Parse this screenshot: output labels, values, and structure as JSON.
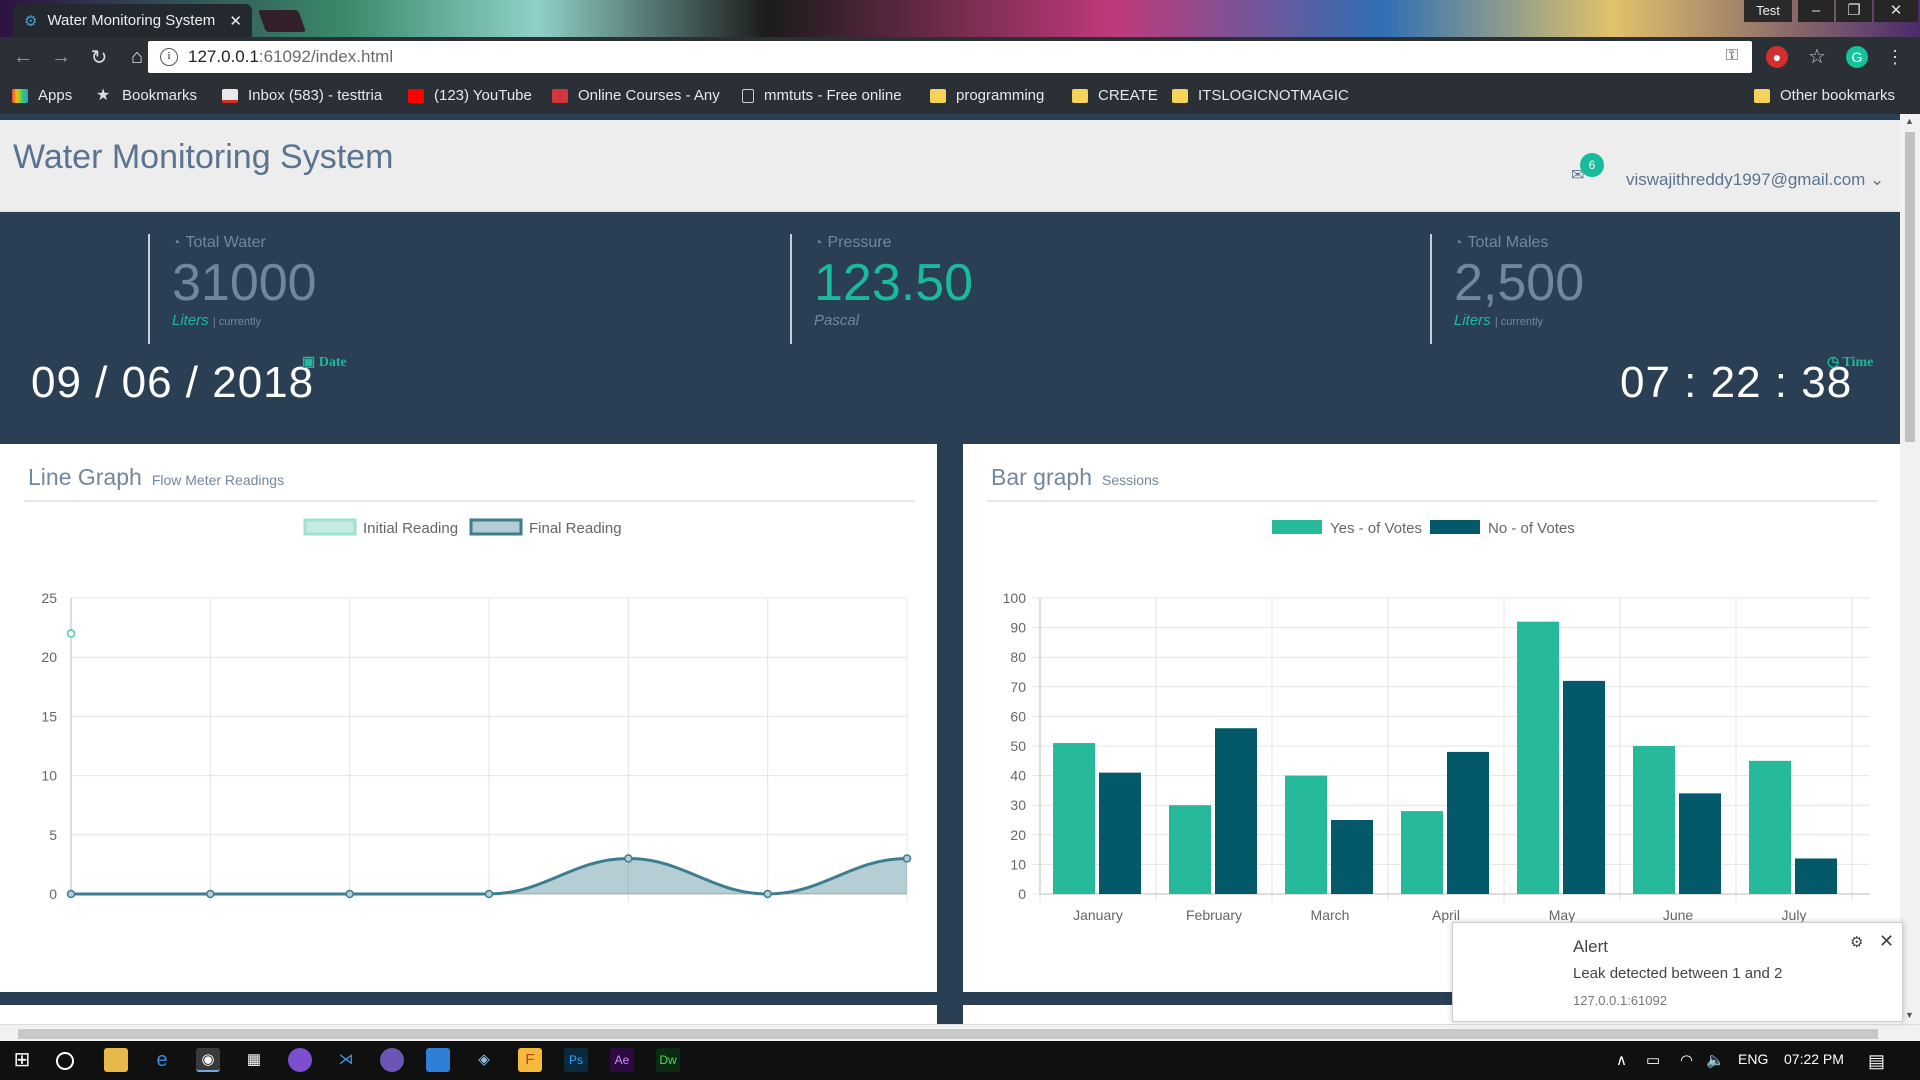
{
  "browser": {
    "tab_title": "Water Monitoring System",
    "profile": "Test",
    "url_host": "127.0.0.1",
    "url_rest": ":61092/index.html",
    "bookmarks": [
      "Apps",
      "Bookmarks",
      "Inbox (583) - testtria",
      "(123) YouTube",
      "Online Courses - Any",
      "mmtuts - Free online",
      "programming",
      "CREATE",
      "ITSLOGICNOTMAGIC"
    ],
    "other_bookmarks": "Other bookmarks"
  },
  "app": {
    "title": "Water Monitoring System",
    "notification_count": "6",
    "user": "viswajithreddy1997@gmail.com"
  },
  "stats": [
    {
      "label": "Total Water",
      "value": "31000",
      "unit": "Liters",
      "note": "| currently"
    },
    {
      "label": "Pressure",
      "value": "123.50",
      "unit": "Pascal",
      "note": ""
    },
    {
      "label": "Total Males",
      "value": "2,500",
      "unit": "Liters",
      "note": "| currently"
    }
  ],
  "date": {
    "value": "09 / 06 / 2018",
    "label": "Date"
  },
  "time": {
    "value": "07 : 22 : 38",
    "label": "Time"
  },
  "line_panel": {
    "title": "Line Graph",
    "subtitle": "Flow Meter Readings"
  },
  "bar_panel": {
    "title": "Bar graph",
    "subtitle": "Sessions"
  },
  "chart_data": [
    {
      "type": "line",
      "x": [
        "",
        "",
        "",
        "",
        "",
        "",
        ""
      ],
      "series": [
        {
          "name": "Initial Reading",
          "values": [
            22,
            null,
            null,
            null,
            null,
            null,
            null
          ],
          "color": "#9fe0d2"
        },
        {
          "name": "Final Reading",
          "values": [
            0,
            0,
            0,
            0,
            3,
            0,
            3
          ],
          "color": "#3d7d8e"
        }
      ],
      "ylim": [
        0,
        25
      ],
      "yticks": [
        0,
        5,
        10,
        15,
        20,
        25
      ],
      "grid": true,
      "legend": "top"
    },
    {
      "type": "bar",
      "categories": [
        "January",
        "February",
        "March",
        "April",
        "May",
        "June",
        "July"
      ],
      "series": [
        {
          "name": "Yes - of Votes",
          "values": [
            51,
            30,
            40,
            28,
            92,
            50,
            45
          ],
          "color": "#26b99a"
        },
        {
          "name": "No - of Votes",
          "values": [
            41,
            56,
            25,
            48,
            72,
            34,
            12
          ],
          "color": "#03586a"
        }
      ],
      "ylim": [
        0,
        100
      ],
      "yticks": [
        0,
        10,
        20,
        30,
        40,
        50,
        60,
        70,
        80,
        90,
        100
      ],
      "grid": true,
      "legend": "top"
    }
  ],
  "notification": {
    "title": "Alert",
    "message": "Leak detected between 1 and 2",
    "source": "127.0.0.1:61092"
  },
  "taskbar": {
    "lang": "ENG",
    "clock": "07:22 PM"
  },
  "icons": [
    "calendar-icon",
    "clock-icon",
    "dashboard-icon",
    "envelope-icon",
    "gear-icon",
    "close-icon"
  ]
}
